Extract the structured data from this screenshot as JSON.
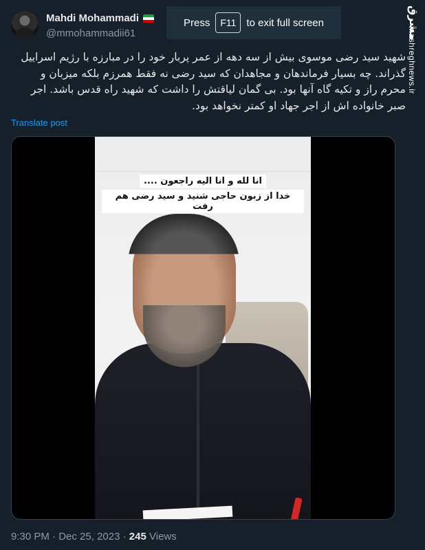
{
  "tweet": {
    "author_name": "Mahdi Mohammadi",
    "flag_icon": "iran-flag-icon",
    "handle": "@mmohammadii61",
    "text_lines": [
      "شهید سید رضی موسوی بیش از سه دهه از عمر پربار خود را در مبارزه با رژیم اسراییل",
      "گذراند. چه بسیار فرماندهان و مجاهدان که سید رضی نه فقط همرزم بلکه میزبان و",
      "محرم راز و تکیه گاه آنها بود. بی گمان لیاقتش را داشت که شهید راه قدس باشد. اجر",
      "صبر خانواده اش از اجر جهاد او کمتر نخواهد بود."
    ],
    "translate_label": "Translate post",
    "time": "9:30 PM",
    "date": "Dec 25, 2023",
    "views_count": "245",
    "views_label": "Views"
  },
  "fullscreen_banner": {
    "prefix": "Press",
    "key": "F11",
    "suffix": "to exit full screen"
  },
  "watermark": {
    "logo_text": "مشرق",
    "site": "mashreghnews.ir"
  },
  "video": {
    "caption_line1": "انا لله و انا الیه راجعون ....",
    "caption_line2": "خدا از زبون حاجی شنید و سید رضی هم رفت"
  },
  "colors": {
    "background": "#15202b",
    "link": "#1d9bf0",
    "secondary_text": "#8b98a5"
  }
}
